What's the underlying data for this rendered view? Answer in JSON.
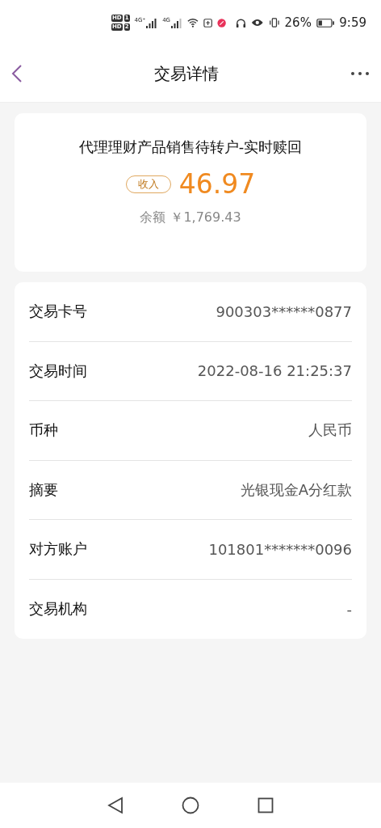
{
  "status_bar": {
    "sims": [
      {
        "badge": "HD",
        "slot": "1"
      },
      {
        "badge": "HD",
        "slot": "2"
      }
    ],
    "networks": [
      "4G⁺",
      "4G"
    ],
    "battery_text": "26%",
    "time": "9:59"
  },
  "header": {
    "title": "交易详情"
  },
  "summary": {
    "title": "代理理财产品销售待转户-实时赎回",
    "tag": "收入",
    "amount": "46.97",
    "balance_label": "余额",
    "balance": "￥1,769.43"
  },
  "details": [
    {
      "label": "交易卡号",
      "value": "900303******0877"
    },
    {
      "label": "交易时间",
      "value": "2022-08-16 21:25:37"
    },
    {
      "label": "币种",
      "value": "人民币"
    },
    {
      "label": "摘要",
      "value": "光银现金A分红款"
    },
    {
      "label": "对方账户",
      "value": "101801*******0096"
    },
    {
      "label": "交易机构",
      "value": "-"
    }
  ]
}
